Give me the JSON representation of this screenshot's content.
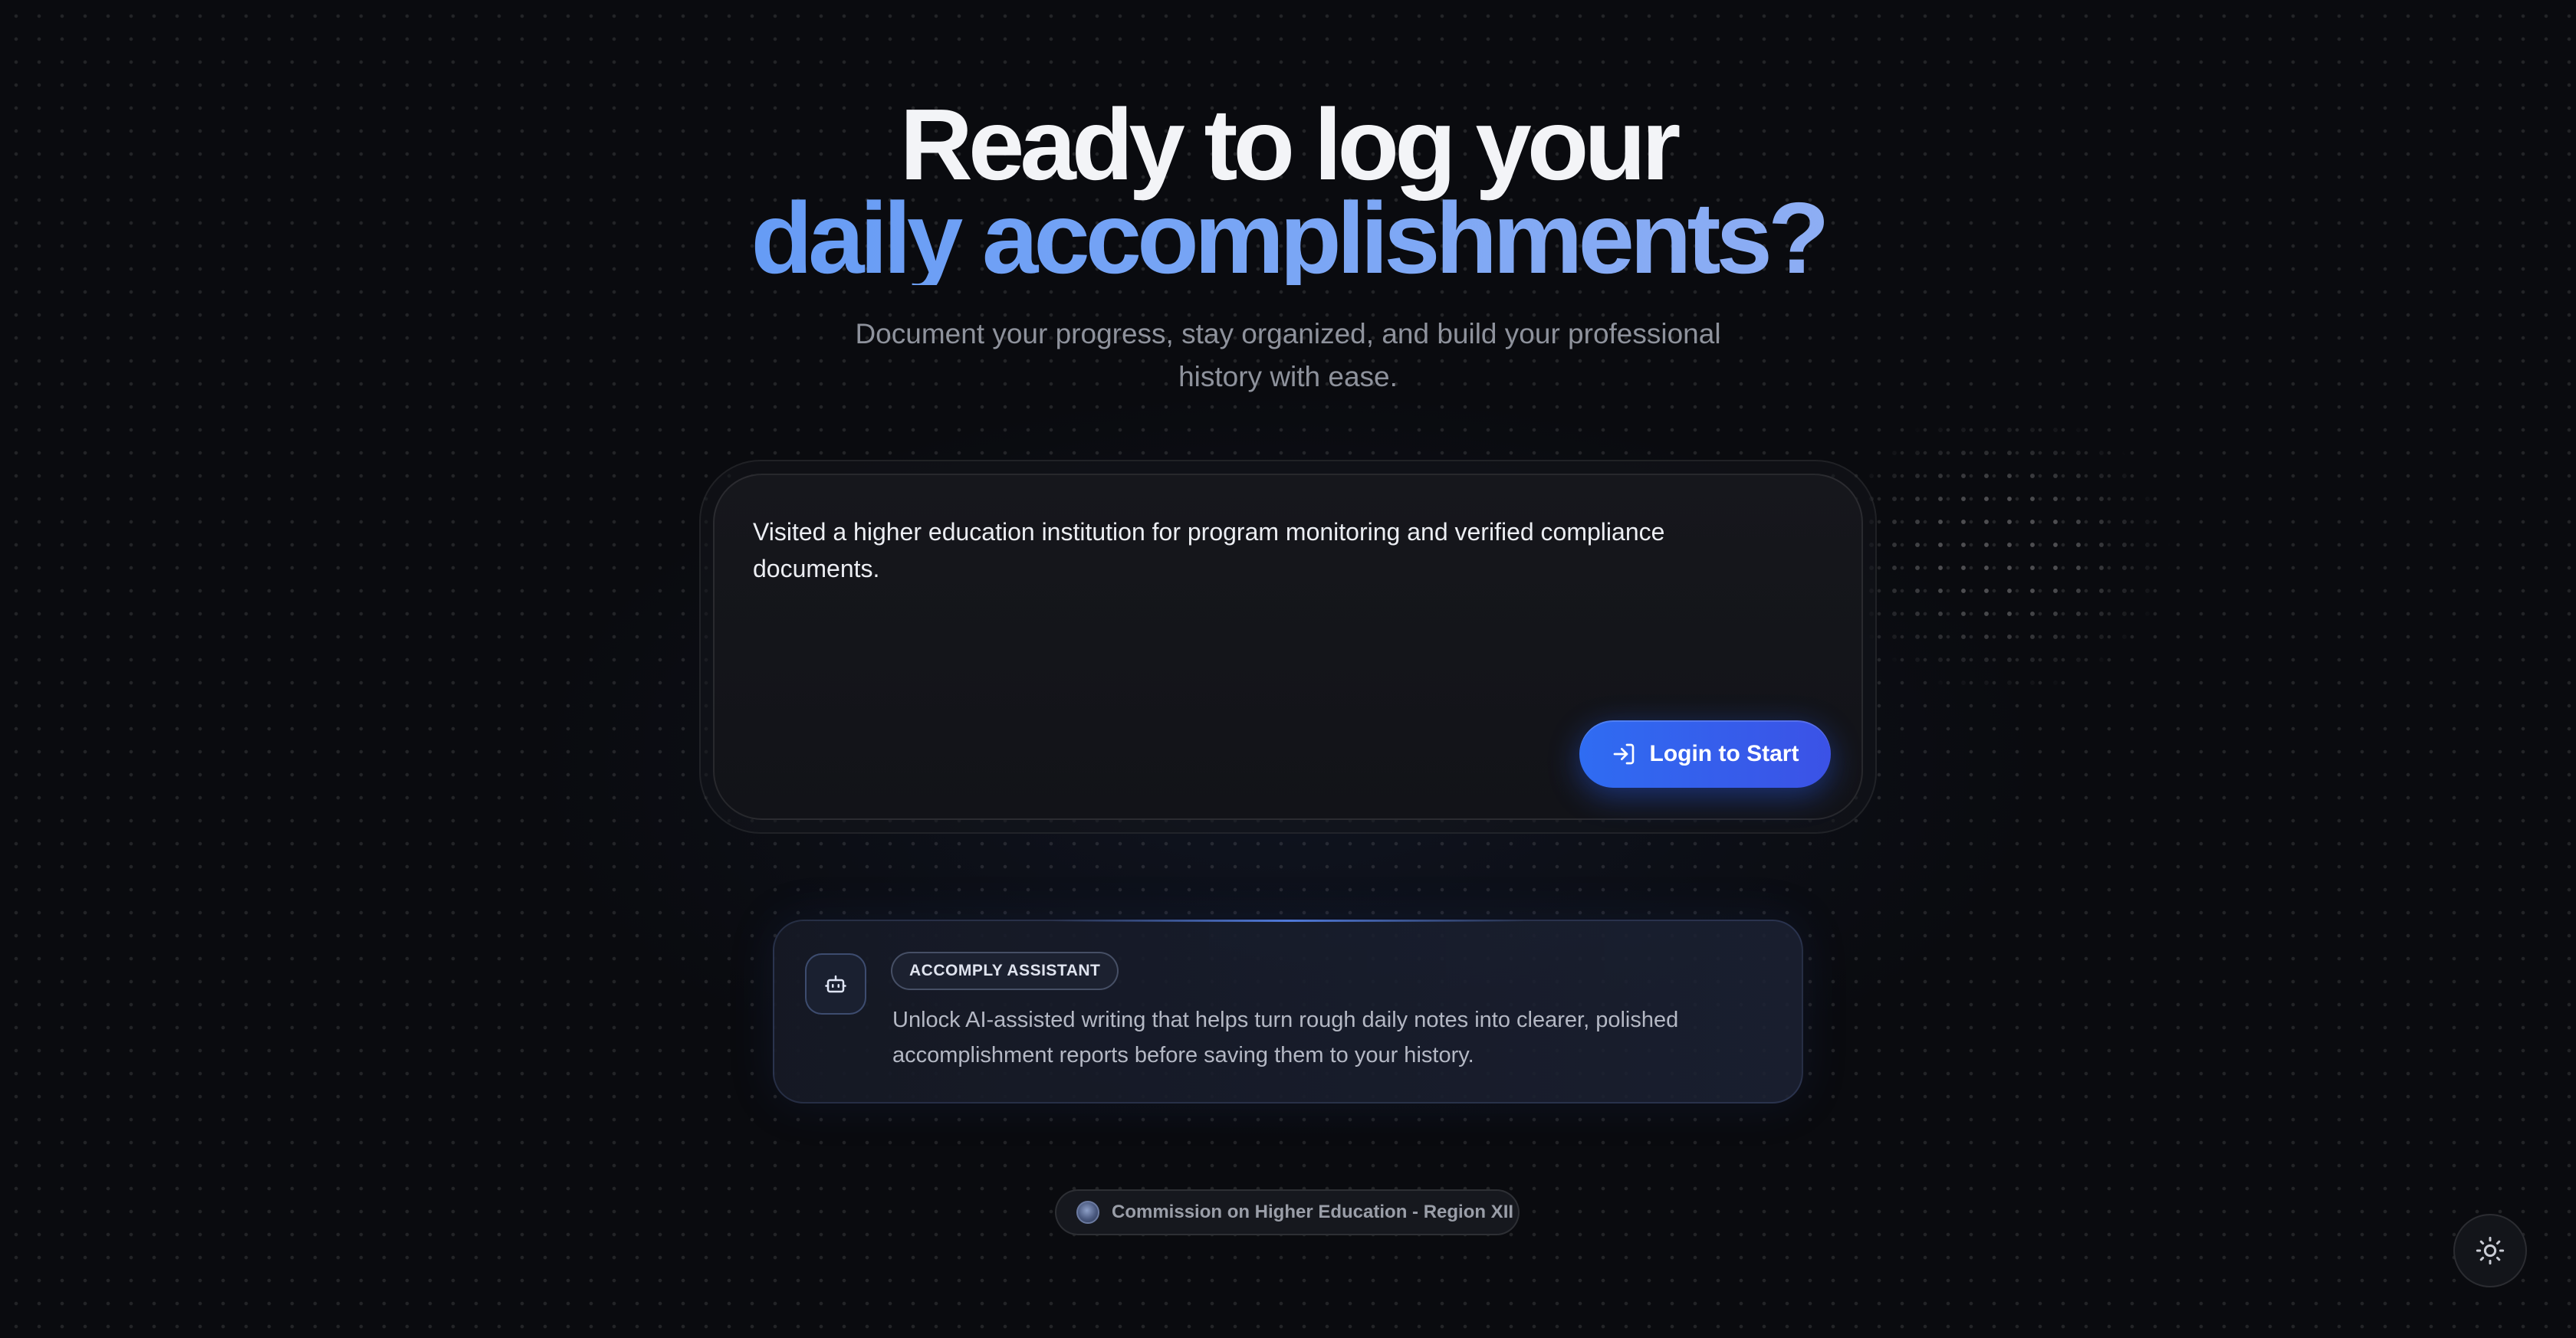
{
  "hero": {
    "title_line1": "Ready to log your",
    "title_line2": "daily accomplishments?",
    "subtitle": "Document your progress, stay organized, and build your professional history with ease."
  },
  "composer": {
    "text": "Visited a higher education institution for program monitoring and verified compliance documents.",
    "login_label": "Login to Start",
    "login_icon": "login-arrow-icon"
  },
  "assistant": {
    "icon": "bot-icon",
    "badge": "ACCOMPLY ASSISTANT",
    "description": "Unlock AI-assisted writing that helps turn rough daily notes into clearer, polished accomplishment reports before saving them to your history."
  },
  "footer": {
    "organization": "Commission on Higher Education - Region XII",
    "icon": "seal-logo"
  },
  "theme_toggle": {
    "icon": "sun-icon"
  },
  "colors": {
    "background": "#0a0b0f",
    "accent": "#2f6cf2",
    "heading_gradient_start": "#4a8df5",
    "heading_gradient_end": "#a8b8f2"
  }
}
